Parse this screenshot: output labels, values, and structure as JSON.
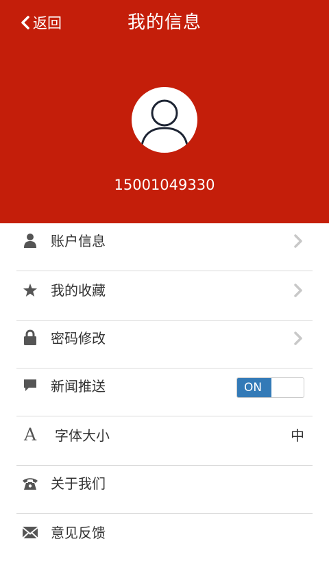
{
  "header": {
    "back_label": "返回",
    "title": "我的信息",
    "phone": "15001049330",
    "back_icon": "chevron-left-icon",
    "avatar_icon": "user-avatar-icon"
  },
  "colors": {
    "header_bg": "#c41e0a",
    "toggle_on": "#337ab7",
    "icon": "#555555",
    "chevron": "#c8c8c8",
    "divider": "#d9d9d9"
  },
  "menu": {
    "items": [
      {
        "label": "账户信息",
        "icon": "user-icon",
        "accessory": "chevron"
      },
      {
        "label": "我的收藏",
        "icon": "star-icon",
        "accessory": "chevron"
      },
      {
        "label": "密码修改",
        "icon": "lock-icon",
        "accessory": "chevron"
      },
      {
        "label": "新闻推送",
        "icon": "comment-icon",
        "accessory": "toggle"
      },
      {
        "label": "字体大小",
        "icon": "font-icon",
        "accessory": "value",
        "value": "中"
      },
      {
        "label": "关于我们",
        "icon": "phone-icon",
        "accessory": "none"
      },
      {
        "label": "意见反馈",
        "icon": "envelope-icon",
        "accessory": "none"
      }
    ],
    "toggle_label": "ON",
    "toggle_state": true
  }
}
